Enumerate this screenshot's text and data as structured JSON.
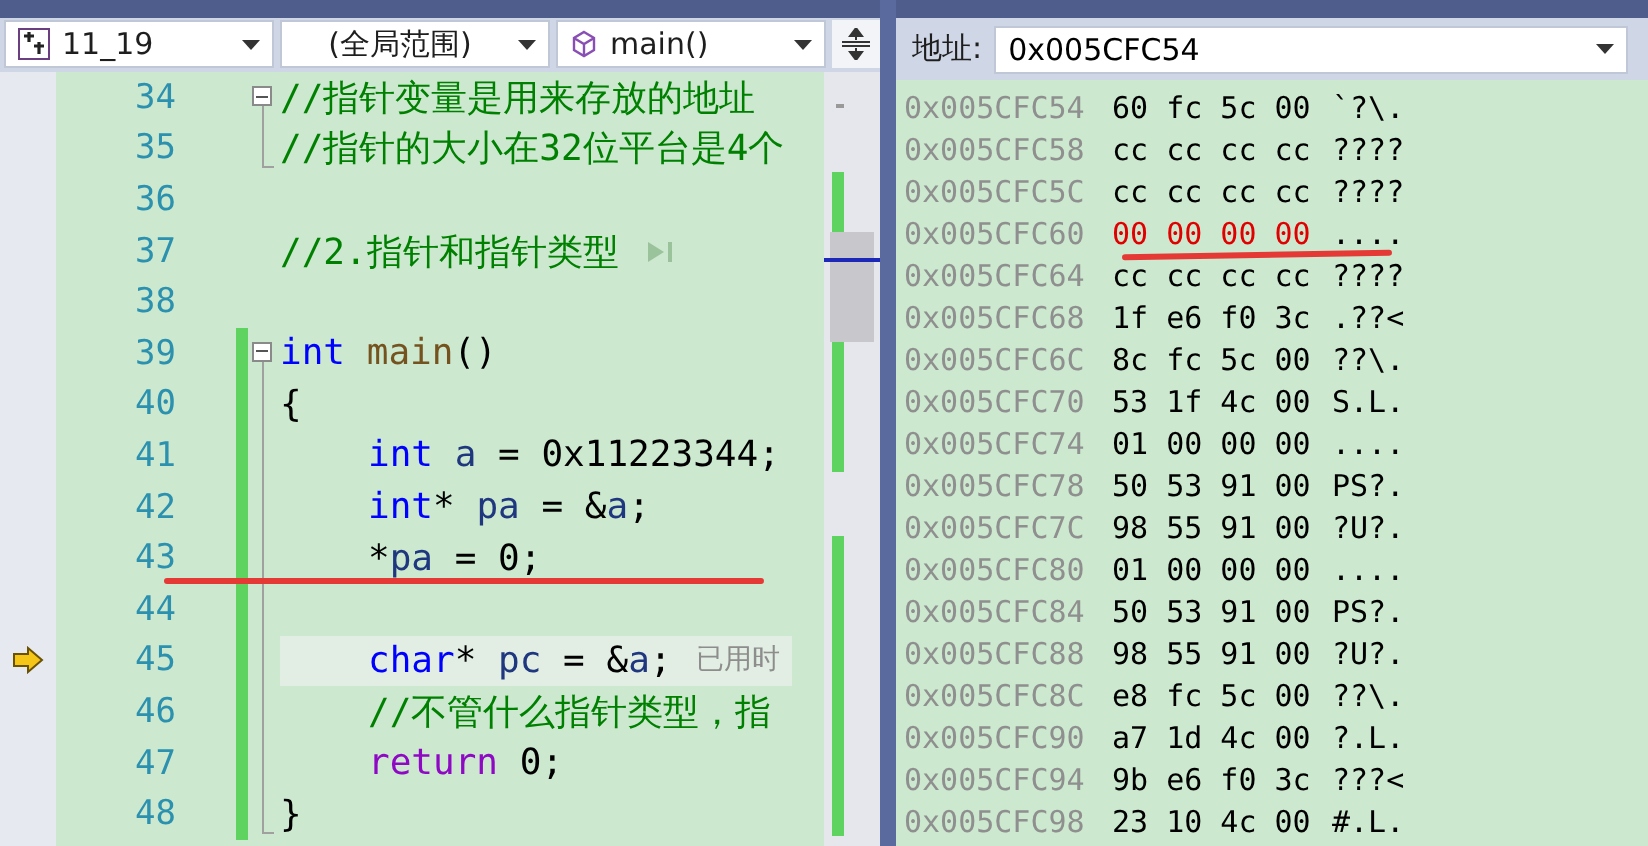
{
  "navigation_bar": {
    "project": "11_19",
    "scope": "(全局范围)",
    "function": "main()"
  },
  "editor": {
    "lines": [
      {
        "number": "34",
        "kind": "fold-start",
        "indented": false,
        "changed": false,
        "current": false,
        "underlined": false,
        "tokens": [
          {
            "kind": "comment",
            "text": "//指针变量是用来存放的地址"
          }
        ]
      },
      {
        "number": "35",
        "kind": "fold-end",
        "indented": false,
        "changed": false,
        "current": false,
        "underlined": false,
        "tokens": [
          {
            "kind": "comment",
            "text": "//指针的大小在32位平台是4个"
          }
        ]
      },
      {
        "number": "36",
        "kind": "plain",
        "indented": false,
        "changed": false,
        "current": false,
        "underlined": false
      },
      {
        "number": "37",
        "kind": "plain",
        "indented": false,
        "changed": false,
        "current": false,
        "underlined": false,
        "tokens": [
          {
            "kind": "comment",
            "text": "//2.指针和指针类型"
          }
        ],
        "collapsed_marker": true
      },
      {
        "number": "38",
        "kind": "plain",
        "indented": false,
        "changed": false,
        "current": false,
        "underlined": false
      },
      {
        "number": "39",
        "kind": "fold-start",
        "indented": false,
        "changed": true,
        "current": false,
        "underlined": false,
        "tokens": [
          {
            "kind": "keyword",
            "text": "int"
          },
          {
            "kind": "function",
            "text": " main"
          },
          {
            "kind": "plain",
            "text": "()"
          }
        ]
      },
      {
        "number": "40",
        "kind": "fold-inner",
        "indented": false,
        "changed": true,
        "current": false,
        "underlined": false,
        "tokens": [
          {
            "kind": "plain",
            "text": "{"
          }
        ]
      },
      {
        "number": "41",
        "kind": "fold-inner",
        "indented": true,
        "changed": true,
        "current": false,
        "underlined": false,
        "tokens": [
          {
            "kind": "keyword",
            "text": "int"
          },
          {
            "kind": "variable",
            "text": " a"
          },
          {
            "kind": "plain",
            "text": " = 0x11223344;"
          }
        ]
      },
      {
        "number": "42",
        "kind": "fold-inner",
        "indented": true,
        "changed": true,
        "current": false,
        "underlined": false,
        "tokens": [
          {
            "kind": "keyword",
            "text": "int"
          },
          {
            "kind": "plain",
            "text": "*"
          },
          {
            "kind": "variable",
            "text": " pa"
          },
          {
            "kind": "plain",
            "text": " = &"
          },
          {
            "kind": "variable",
            "text": "a"
          },
          {
            "kind": "plain",
            "text": ";"
          }
        ]
      },
      {
        "number": "43",
        "kind": "fold-inner",
        "indented": true,
        "changed": true,
        "current": false,
        "underlined": true,
        "tokens": [
          {
            "kind": "plain",
            "text": "*"
          },
          {
            "kind": "variable",
            "text": "pa"
          },
          {
            "kind": "plain",
            "text": " = 0;"
          }
        ]
      },
      {
        "number": "44",
        "kind": "fold-inner",
        "indented": false,
        "changed": true,
        "current": false,
        "underlined": false
      },
      {
        "number": "45",
        "kind": "fold-inner",
        "indented": true,
        "changed": true,
        "current": true,
        "underlined": false,
        "tokens": [
          {
            "kind": "keyword",
            "text": "char"
          },
          {
            "kind": "plain",
            "text": "*"
          },
          {
            "kind": "variable",
            "text": " pc"
          },
          {
            "kind": "plain",
            "text": " = &"
          },
          {
            "kind": "variable",
            "text": "a"
          },
          {
            "kind": "plain",
            "text": ";"
          }
        ],
        "hint": "已用时"
      },
      {
        "number": "46",
        "kind": "fold-inner",
        "indented": true,
        "changed": true,
        "current": false,
        "underlined": false,
        "tokens": [
          {
            "kind": "comment",
            "text": "//不管什么指针类型，指"
          }
        ]
      },
      {
        "number": "47",
        "kind": "fold-inner",
        "indented": true,
        "changed": true,
        "current": false,
        "underlined": false,
        "tokens": [
          {
            "kind": "control",
            "text": "return"
          },
          {
            "kind": "plain",
            "text": " 0;"
          }
        ]
      },
      {
        "number": "48",
        "kind": "fold-end",
        "indented": false,
        "changed": true,
        "current": false,
        "underlined": false,
        "tokens": [
          {
            "kind": "plain",
            "text": "}"
          }
        ]
      }
    ]
  },
  "memory": {
    "address_label": "地址:",
    "address": "0x005CFC54",
    "rows": [
      {
        "address": "0x005CFC54",
        "bytes": "60 fc 5c 00",
        "ascii": "`?\\.",
        "changed": false,
        "underlined": false
      },
      {
        "address": "0x005CFC58",
        "bytes": "cc cc cc cc",
        "ascii": "????",
        "changed": false,
        "underlined": false
      },
      {
        "address": "0x005CFC5C",
        "bytes": "cc cc cc cc",
        "ascii": "????",
        "changed": false,
        "underlined": false
      },
      {
        "address": "0x005CFC60",
        "bytes": "00 00 00 00",
        "ascii": "....",
        "changed": true,
        "underlined": true
      },
      {
        "address": "0x005CFC64",
        "bytes": "cc cc cc cc",
        "ascii": "????",
        "changed": false,
        "underlined": false
      },
      {
        "address": "0x005CFC68",
        "bytes": "1f e6 f0 3c",
        "ascii": ".??<",
        "changed": false,
        "underlined": false
      },
      {
        "address": "0x005CFC6C",
        "bytes": "8c fc 5c 00",
        "ascii": "??\\.",
        "changed": false,
        "underlined": false
      },
      {
        "address": "0x005CFC70",
        "bytes": "53 1f 4c 00",
        "ascii": "S.L.",
        "changed": false,
        "underlined": false
      },
      {
        "address": "0x005CFC74",
        "bytes": "01 00 00 00",
        "ascii": "....",
        "changed": false,
        "underlined": false
      },
      {
        "address": "0x005CFC78",
        "bytes": "50 53 91 00",
        "ascii": "PS?.",
        "changed": false,
        "underlined": false
      },
      {
        "address": "0x005CFC7C",
        "bytes": "98 55 91 00",
        "ascii": "?U?.",
        "changed": false,
        "underlined": false
      },
      {
        "address": "0x005CFC80",
        "bytes": "01 00 00 00",
        "ascii": "....",
        "changed": false,
        "underlined": false
      },
      {
        "address": "0x005CFC84",
        "bytes": "50 53 91 00",
        "ascii": "PS?.",
        "changed": false,
        "underlined": false
      },
      {
        "address": "0x005CFC88",
        "bytes": "98 55 91 00",
        "ascii": "?U?.",
        "changed": false,
        "underlined": false
      },
      {
        "address": "0x005CFC8C",
        "bytes": "e8 fc 5c 00",
        "ascii": "??\\.",
        "changed": false,
        "underlined": false
      },
      {
        "address": "0x005CFC90",
        "bytes": "a7 1d 4c 00",
        "ascii": "?.L.",
        "changed": false,
        "underlined": false
      },
      {
        "address": "0x005CFC94",
        "bytes": "9b e6 f0 3c",
        "ascii": "???<",
        "changed": false,
        "underlined": false
      },
      {
        "address": "0x005CFC98",
        "bytes": "23 10 4c 00",
        "ascii": "#.L.",
        "changed": false,
        "underlined": false
      }
    ]
  }
}
